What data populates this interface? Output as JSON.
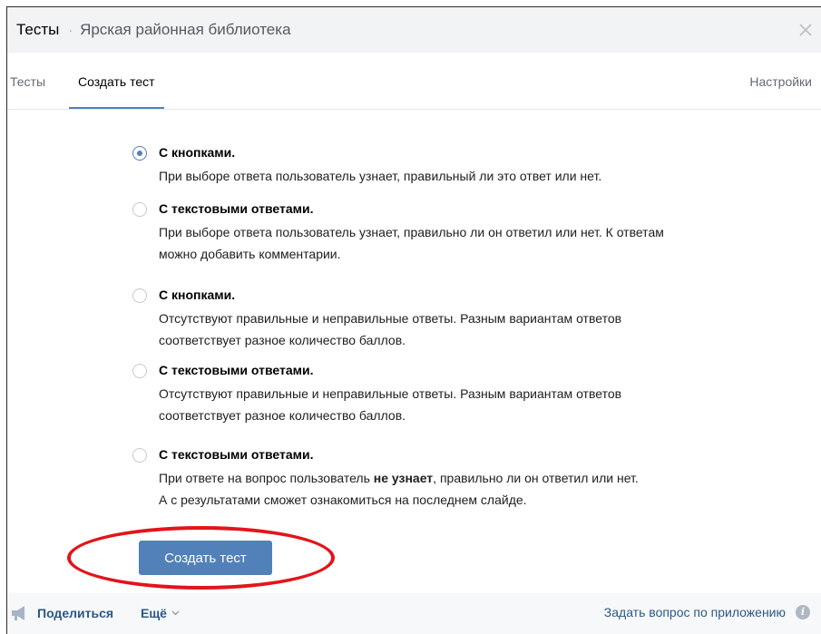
{
  "header": {
    "title": "Тесты",
    "separator": "·",
    "subtitle": "Ярская районная библиотека"
  },
  "tabs": [
    {
      "label": "Тесты",
      "active": false
    },
    {
      "label": "Создать тест",
      "active": true
    },
    {
      "label": "Настройки",
      "active": false
    }
  ],
  "options": [
    {
      "title": "С кнопками.",
      "description": "При выборе ответа пользователь узнает, правильный ли это ответ или нет.",
      "selected": true
    },
    {
      "title": "С текстовыми ответами.",
      "description": "При выборе ответа пользователь узнает, правильно ли он ответил или нет. К ответам можно добавить комментарии.",
      "selected": false
    },
    {
      "title": "С кнопками.",
      "description": "Отсутствуют правильные и неправильные ответы. Разным вариантам ответов соответствует разное количество баллов.",
      "selected": false
    },
    {
      "title": "С текстовыми ответами.",
      "description": "Отсутствуют правильные и неправильные ответы. Разным вариантам ответов соответствует разное количество баллов.",
      "selected": false
    },
    {
      "title": "С текстовыми ответами.",
      "description_before": "При ответе на вопрос пользователь ",
      "description_bold": "не узнает",
      "description_after": ", правильно ли он ответил или нет.",
      "description_line2": "А с результатами сможет ознакомиться на последнем слайде.",
      "selected": false
    }
  ],
  "create_button": {
    "label": "Создать тест"
  },
  "footer": {
    "share_label": "Поделиться",
    "more_label": "Ещё",
    "ask_label": "Задать вопрос по приложению",
    "info_glyph": "i"
  },
  "colors": {
    "accent": "#5181b8",
    "link": "#2a5885",
    "annotation": "#e3141b",
    "header_bg": "#f2f3f5"
  },
  "icons": {
    "close": "close-icon",
    "share": "megaphone-icon",
    "more": "chevron-down-icon",
    "info": "info-icon"
  }
}
